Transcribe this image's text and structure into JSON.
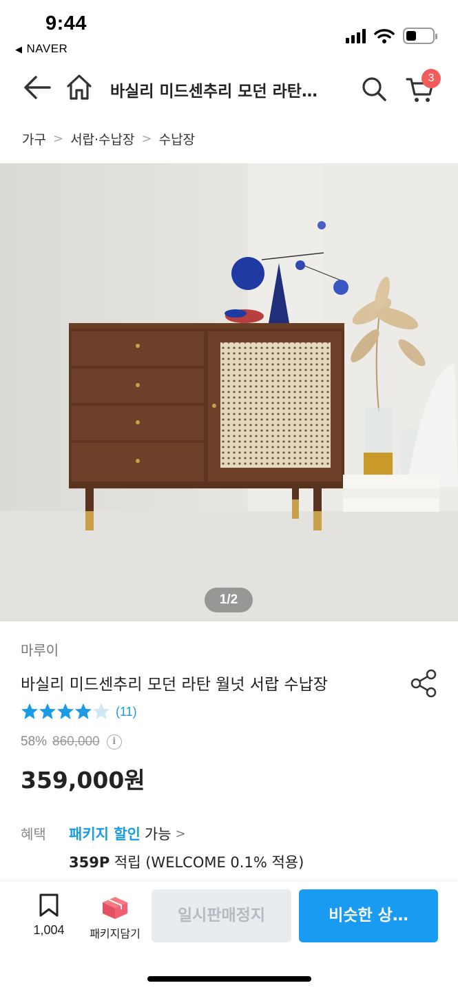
{
  "status_bar": {
    "time": "9:44",
    "back_app": "NAVER"
  },
  "nav": {
    "title": "바실리 미드센추리 모던 라탄…",
    "cart_badge": "3"
  },
  "breadcrumb": [
    "가구",
    "서랍·수납장",
    "수납장"
  ],
  "image": {
    "counter": "1/2"
  },
  "product": {
    "seller": "마루이",
    "name": "바실리 미드센추리 모던 라탄 월넛 서랍 수납장",
    "rating": 4.5,
    "review_count": "(11)",
    "discount": "58%",
    "original_price": "860,000",
    "sale_price": "359,000원"
  },
  "benefit": {
    "label": "혜택",
    "package_discount": "패키지 할인",
    "available": "가능",
    "points_amount": "359P",
    "points_text": "적립 (WELCOME 0.1% 적용)"
  },
  "bottom_bar": {
    "wishlist_count": "1,004",
    "package_label": "패키지담기",
    "soldout_label": "일시판매정지",
    "similar_label": "비슷한 상…"
  },
  "colors": {
    "accent": "#1a9bf2",
    "badge": "#f45b5b",
    "star": "#1a9be6"
  }
}
